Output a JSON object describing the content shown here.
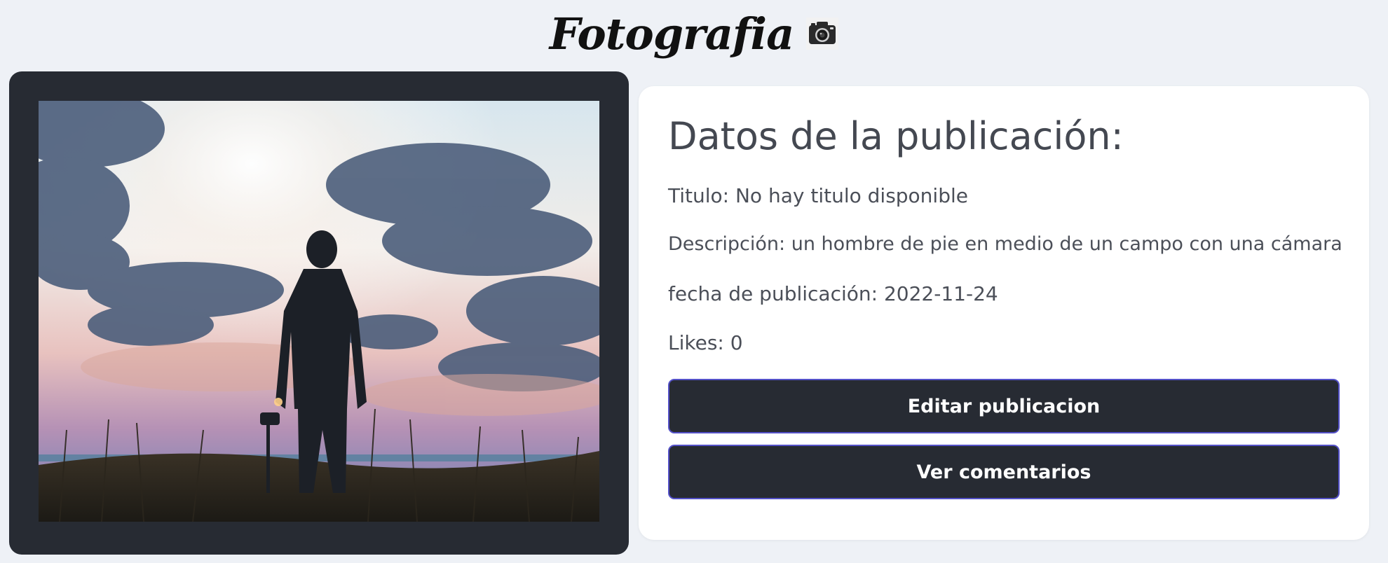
{
  "header": {
    "title": "Fotografia",
    "icon": "camera-icon"
  },
  "photo": {
    "description": "un hombre de pie en medio de un campo con una cámara"
  },
  "post_details": {
    "heading": "Datos de la publicación:",
    "title_text": "Titulo: No hay titulo disponible",
    "description_text": "Descripción: un hombre de pie en medio de un campo con una cámara",
    "date_text": "fecha de publicación: 2022-11-24",
    "likes_text": "Likes: 0"
  },
  "actions": {
    "edit_label": "Editar publicacion",
    "comments_label": "Ver comentarios"
  },
  "colors": {
    "page_background": "#eef1f6",
    "panel_dark": "#272b33",
    "button_border": "#5451c8",
    "text_muted": "#4b4f58"
  }
}
